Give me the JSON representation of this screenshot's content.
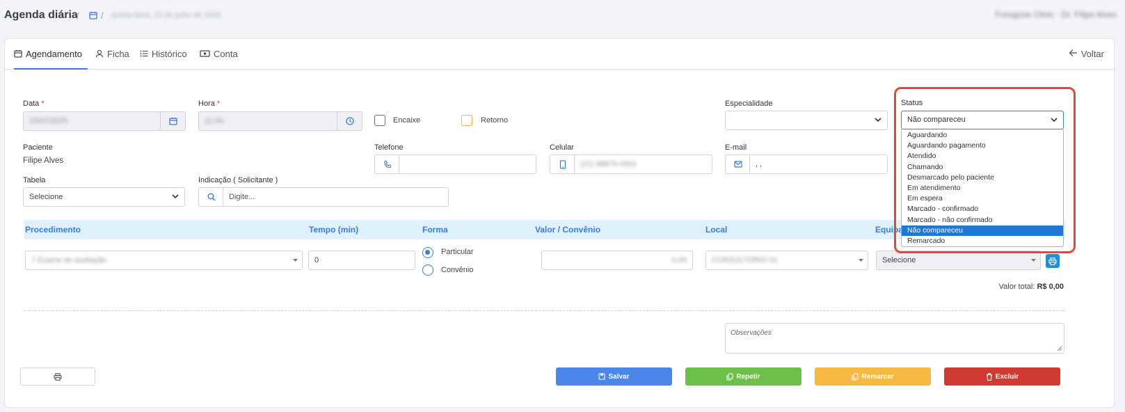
{
  "header": {
    "title": "Agenda diária",
    "breadcrumb_sep": "/",
    "breadcrumb_date": "quinta-feira, 15 de julho de 2025",
    "clinic": "Foregone Clinic · Dr. Filipe Alves"
  },
  "tabs": [
    {
      "label": "Agendamento",
      "icon": "calendar-icon"
    },
    {
      "label": "Ficha",
      "icon": "user-icon"
    },
    {
      "label": "Histórico",
      "icon": "list-icon"
    },
    {
      "label": "Conta",
      "icon": "money-icon"
    }
  ],
  "back_label": "Voltar",
  "form": {
    "data_label": "Data",
    "data_value": "15/07/2025",
    "hora_label": "Hora",
    "hora_value": "11:00",
    "required_mark": "*",
    "encaixe_label": "Encaixe",
    "retorno_label": "Retorno",
    "especialidade_label": "Especialidade",
    "especialidade_value": "",
    "status_label": "Status",
    "status_value": "Não compareceu",
    "paciente_label": "Paciente",
    "paciente_value": "Filipe Alves",
    "telefone_label": "Telefone",
    "telefone_value": "",
    "celular_label": "Celular",
    "celular_value": "(21) 98876-0001",
    "email_label": "E-mail",
    "email_value": ", ,",
    "tabela_label": "Tabela",
    "tabela_value": "Selecione",
    "indicacao_label": "Indicação ( Solicitante )",
    "indicacao_placeholder": "Digite..."
  },
  "status_options": [
    "Aguardando",
    "Aguardando pagamento",
    "Atendido",
    "Chamando",
    "Desmarcado pelo paciente",
    "Em atendimento",
    "Em espera",
    "Marcado - confirmado",
    "Marcado - não confirmado",
    "Não compareceu",
    "Remarcado"
  ],
  "status_selected_index": 9,
  "procedure": {
    "headers": {
      "procedimento": "Procedimento",
      "tempo": "Tempo (min)",
      "forma": "Forma",
      "valor": "Valor / Convênio",
      "local": "Local",
      "equipamento": "Equipamento"
    },
    "procedimento_value": "7 Exame de avaliação",
    "tempo_value": "0",
    "forma_particular": "Particular",
    "forma_convenio": "Convênio",
    "valor_value": "0,00",
    "local_value": "CONSULTÓRIO 01",
    "equipamento_value": "Selecione"
  },
  "total_label": "Valor total:",
  "total_value": "R$ 0,00",
  "observacoes_placeholder": "Observações",
  "buttons": {
    "salvar": "Salvar",
    "repetir": "Repetir",
    "remarcar": "Remarcar",
    "excluir": "Excluir"
  },
  "colors": {
    "primary": "#3b7bd9",
    "salvar": "#4a86e8",
    "repetir": "#6cc04a",
    "remarcar": "#f5b942",
    "excluir": "#d03a32",
    "highlight": "#e04a3a"
  }
}
